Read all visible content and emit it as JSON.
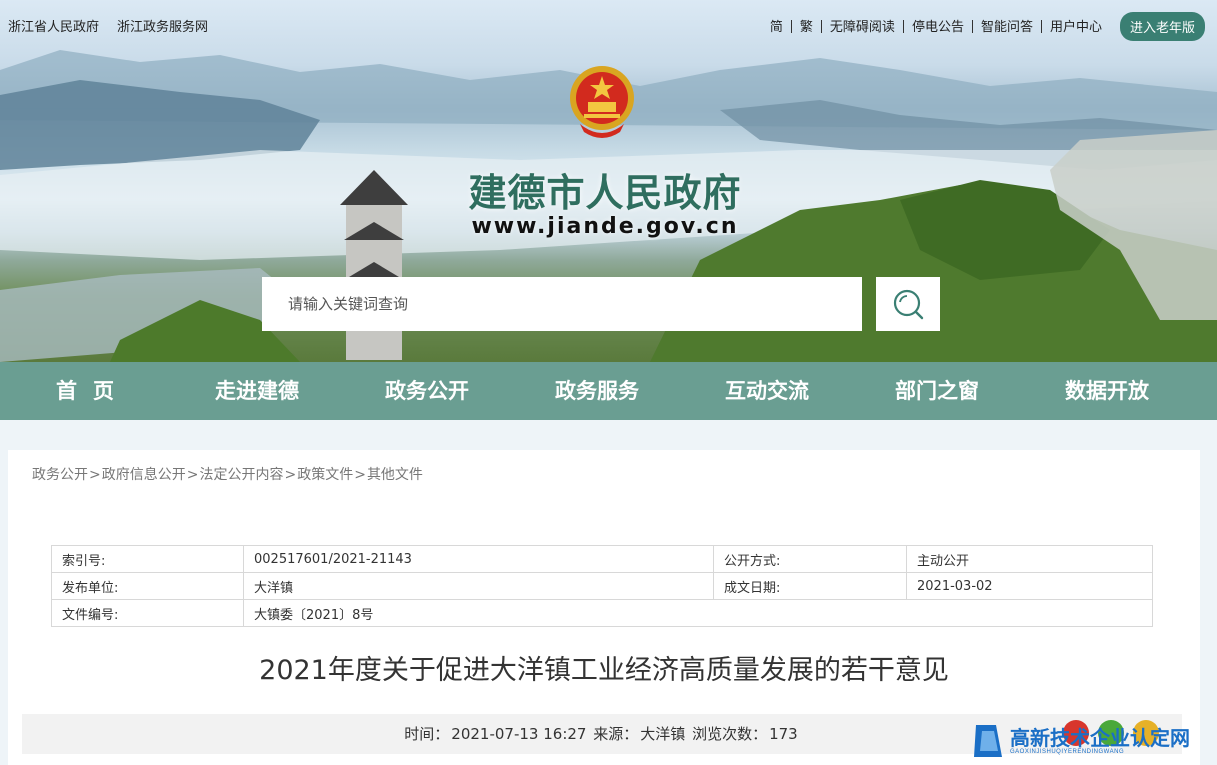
{
  "topbar": {
    "left_links": [
      "浙江省人民政府",
      "浙江政务服务网"
    ],
    "right_links": [
      "简",
      "繁",
      "无障碍阅读",
      "停电公告",
      "智能问答",
      "用户中心"
    ],
    "elder_button": "进入老年版"
  },
  "header": {
    "site_title": "建德市人民政府",
    "site_url": "www.jiande.gov.cn",
    "emblem_icon": "national-emblem-icon"
  },
  "search": {
    "placeholder": "请输入关键词查询",
    "button_icon": "search-icon"
  },
  "nav": {
    "items": [
      "首页",
      "走进建德",
      "政务公开",
      "政务服务",
      "互动交流",
      "部门之窗",
      "数据开放"
    ]
  },
  "breadcrumb": [
    "政务公开",
    "政府信息公开",
    "法定公开内容",
    "政策文件",
    "其他文件"
  ],
  "meta": {
    "index_label": "索引号:",
    "index_value": "002517601/2021-21143",
    "disclosure_label": "公开方式:",
    "disclosure_value": "主动公开",
    "publisher_label": "发布单位:",
    "publisher_value": "大洋镇",
    "date_label": "成文日期:",
    "date_value": "2021-03-02",
    "docno_label": "文件编号:",
    "docno_value": "大镇委〔2021〕8号"
  },
  "document": {
    "title": "2021年度关于促进大洋镇工业经济高质量发展的若干意见"
  },
  "info": {
    "time_label": "时间：",
    "time_value": "2021-07-13 16:27",
    "source_label": "来源：",
    "source_value": "大洋镇",
    "views_label": "浏览次数：",
    "views_value": "173"
  },
  "watermark": {
    "cn": "高新技术企业认定网",
    "en": "GAOXINJISHUQIYERENDINGWANG"
  },
  "colors": {
    "nav_bg": "#6a9e92",
    "title_green": "#2f6e5f",
    "elder_btn": "#3a7f73",
    "watermark_blue": "#1b6fc6"
  }
}
